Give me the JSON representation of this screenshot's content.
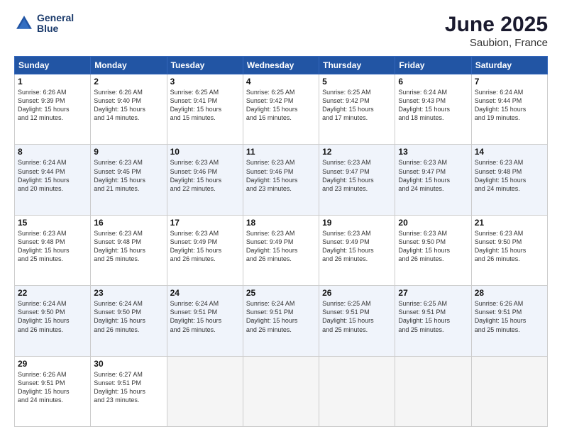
{
  "header": {
    "logo_line1": "General",
    "logo_line2": "Blue",
    "month_year": "June 2025",
    "location": "Saubion, France"
  },
  "days_of_week": [
    "Sunday",
    "Monday",
    "Tuesday",
    "Wednesday",
    "Thursday",
    "Friday",
    "Saturday"
  ],
  "weeks": [
    [
      {
        "day": 1,
        "lines": [
          "Sunrise: 6:26 AM",
          "Sunset: 9:39 PM",
          "Daylight: 15 hours",
          "and 12 minutes."
        ]
      },
      {
        "day": 2,
        "lines": [
          "Sunrise: 6:26 AM",
          "Sunset: 9:40 PM",
          "Daylight: 15 hours",
          "and 14 minutes."
        ]
      },
      {
        "day": 3,
        "lines": [
          "Sunrise: 6:25 AM",
          "Sunset: 9:41 PM",
          "Daylight: 15 hours",
          "and 15 minutes."
        ]
      },
      {
        "day": 4,
        "lines": [
          "Sunrise: 6:25 AM",
          "Sunset: 9:42 PM",
          "Daylight: 15 hours",
          "and 16 minutes."
        ]
      },
      {
        "day": 5,
        "lines": [
          "Sunrise: 6:25 AM",
          "Sunset: 9:42 PM",
          "Daylight: 15 hours",
          "and 17 minutes."
        ]
      },
      {
        "day": 6,
        "lines": [
          "Sunrise: 6:24 AM",
          "Sunset: 9:43 PM",
          "Daylight: 15 hours",
          "and 18 minutes."
        ]
      },
      {
        "day": 7,
        "lines": [
          "Sunrise: 6:24 AM",
          "Sunset: 9:44 PM",
          "Daylight: 15 hours",
          "and 19 minutes."
        ]
      }
    ],
    [
      {
        "day": 8,
        "lines": [
          "Sunrise: 6:24 AM",
          "Sunset: 9:44 PM",
          "Daylight: 15 hours",
          "and 20 minutes."
        ]
      },
      {
        "day": 9,
        "lines": [
          "Sunrise: 6:23 AM",
          "Sunset: 9:45 PM",
          "Daylight: 15 hours",
          "and 21 minutes."
        ]
      },
      {
        "day": 10,
        "lines": [
          "Sunrise: 6:23 AM",
          "Sunset: 9:46 PM",
          "Daylight: 15 hours",
          "and 22 minutes."
        ]
      },
      {
        "day": 11,
        "lines": [
          "Sunrise: 6:23 AM",
          "Sunset: 9:46 PM",
          "Daylight: 15 hours",
          "and 23 minutes."
        ]
      },
      {
        "day": 12,
        "lines": [
          "Sunrise: 6:23 AM",
          "Sunset: 9:47 PM",
          "Daylight: 15 hours",
          "and 23 minutes."
        ]
      },
      {
        "day": 13,
        "lines": [
          "Sunrise: 6:23 AM",
          "Sunset: 9:47 PM",
          "Daylight: 15 hours",
          "and 24 minutes."
        ]
      },
      {
        "day": 14,
        "lines": [
          "Sunrise: 6:23 AM",
          "Sunset: 9:48 PM",
          "Daylight: 15 hours",
          "and 24 minutes."
        ]
      }
    ],
    [
      {
        "day": 15,
        "lines": [
          "Sunrise: 6:23 AM",
          "Sunset: 9:48 PM",
          "Daylight: 15 hours",
          "and 25 minutes."
        ]
      },
      {
        "day": 16,
        "lines": [
          "Sunrise: 6:23 AM",
          "Sunset: 9:48 PM",
          "Daylight: 15 hours",
          "and 25 minutes."
        ]
      },
      {
        "day": 17,
        "lines": [
          "Sunrise: 6:23 AM",
          "Sunset: 9:49 PM",
          "Daylight: 15 hours",
          "and 26 minutes."
        ]
      },
      {
        "day": 18,
        "lines": [
          "Sunrise: 6:23 AM",
          "Sunset: 9:49 PM",
          "Daylight: 15 hours",
          "and 26 minutes."
        ]
      },
      {
        "day": 19,
        "lines": [
          "Sunrise: 6:23 AM",
          "Sunset: 9:49 PM",
          "Daylight: 15 hours",
          "and 26 minutes."
        ]
      },
      {
        "day": 20,
        "lines": [
          "Sunrise: 6:23 AM",
          "Sunset: 9:50 PM",
          "Daylight: 15 hours",
          "and 26 minutes."
        ]
      },
      {
        "day": 21,
        "lines": [
          "Sunrise: 6:23 AM",
          "Sunset: 9:50 PM",
          "Daylight: 15 hours",
          "and 26 minutes."
        ]
      }
    ],
    [
      {
        "day": 22,
        "lines": [
          "Sunrise: 6:24 AM",
          "Sunset: 9:50 PM",
          "Daylight: 15 hours",
          "and 26 minutes."
        ]
      },
      {
        "day": 23,
        "lines": [
          "Sunrise: 6:24 AM",
          "Sunset: 9:50 PM",
          "Daylight: 15 hours",
          "and 26 minutes."
        ]
      },
      {
        "day": 24,
        "lines": [
          "Sunrise: 6:24 AM",
          "Sunset: 9:51 PM",
          "Daylight: 15 hours",
          "and 26 minutes."
        ]
      },
      {
        "day": 25,
        "lines": [
          "Sunrise: 6:24 AM",
          "Sunset: 9:51 PM",
          "Daylight: 15 hours",
          "and 26 minutes."
        ]
      },
      {
        "day": 26,
        "lines": [
          "Sunrise: 6:25 AM",
          "Sunset: 9:51 PM",
          "Daylight: 15 hours",
          "and 25 minutes."
        ]
      },
      {
        "day": 27,
        "lines": [
          "Sunrise: 6:25 AM",
          "Sunset: 9:51 PM",
          "Daylight: 15 hours",
          "and 25 minutes."
        ]
      },
      {
        "day": 28,
        "lines": [
          "Sunrise: 6:26 AM",
          "Sunset: 9:51 PM",
          "Daylight: 15 hours",
          "and 25 minutes."
        ]
      }
    ],
    [
      {
        "day": 29,
        "lines": [
          "Sunrise: 6:26 AM",
          "Sunset: 9:51 PM",
          "Daylight: 15 hours",
          "and 24 minutes."
        ]
      },
      {
        "day": 30,
        "lines": [
          "Sunrise: 6:27 AM",
          "Sunset: 9:51 PM",
          "Daylight: 15 hours",
          "and 23 minutes."
        ]
      },
      null,
      null,
      null,
      null,
      null
    ]
  ]
}
